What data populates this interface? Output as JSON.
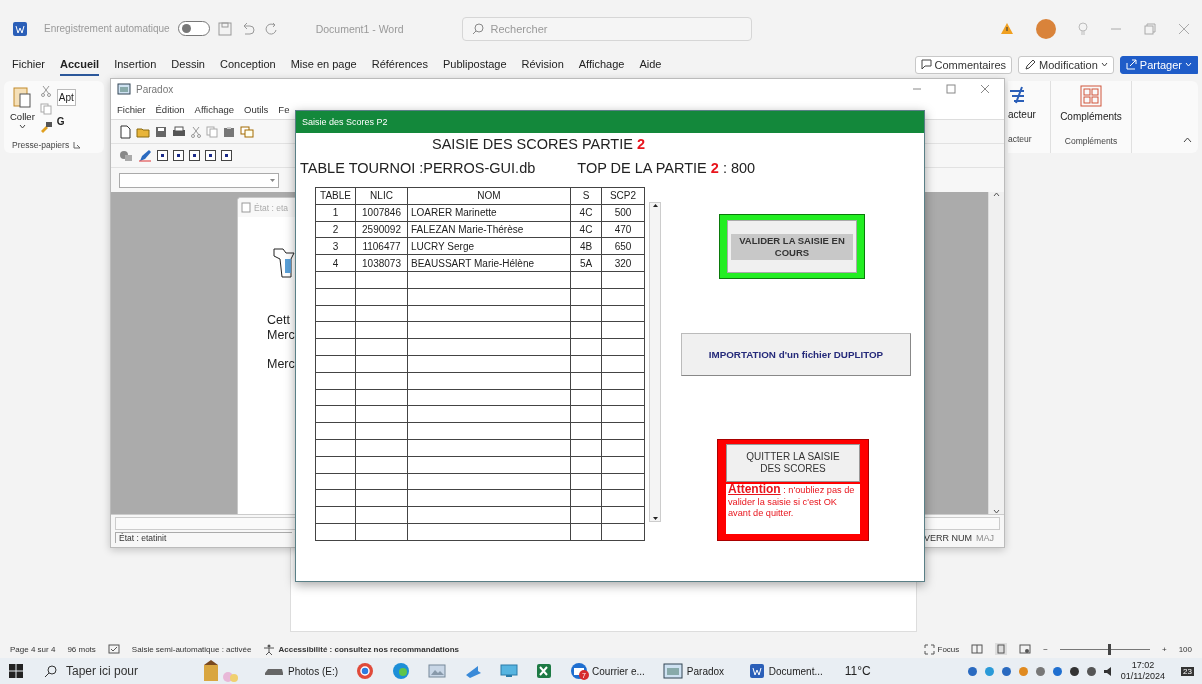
{
  "word": {
    "title": "Document1  -  Word",
    "autosave": {
      "label": "Enregistrement automatique",
      "on": false
    },
    "search": {
      "placeholder": "Rechercher"
    },
    "menu": [
      {
        "label": "Fichier",
        "selected": false
      },
      {
        "label": "Accueil",
        "selected": true
      },
      {
        "label": "Insertion",
        "selected": false
      },
      {
        "label": "Dessin",
        "selected": false
      },
      {
        "label": "Conception",
        "selected": false
      },
      {
        "label": "Mise en page",
        "selected": false
      },
      {
        "label": "Références",
        "selected": false
      },
      {
        "label": "Publipostage",
        "selected": false
      },
      {
        "label": "Révision",
        "selected": false
      },
      {
        "label": "Affichage",
        "selected": false
      },
      {
        "label": "Aide",
        "selected": false
      }
    ],
    "actions": [
      {
        "label": "Commentaires",
        "kind": "comment"
      },
      {
        "label": "Modification",
        "kind": "edit"
      },
      {
        "label": "Partager",
        "kind": "share"
      }
    ],
    "ribbon": {
      "paste": "Coller",
      "font_box": "Apt",
      "bold": "G",
      "clipboard_group": "Presse-papiers",
      "editor": "acteur",
      "editor_group": "acteur",
      "addins": "Compléments",
      "addins_group": "Compléments"
    },
    "status": {
      "page": "Page 4 sur 4",
      "words": "96 mots",
      "autocomplete": "Saisie semi-automatique : activée",
      "accessibility": "Accessibilité : consultez nos recommandations",
      "focus": "Focus",
      "zoom_out": "−",
      "zoom_slider": {
        "level": 0.55
      },
      "zoom_in": "+",
      "zoom": "100"
    }
  },
  "paradox": {
    "title": "Paradox",
    "menu": [
      "Fichier",
      "Édition",
      "Affichage",
      "Outils",
      "Fe"
    ],
    "report": {
      "title": "État : eta",
      "lines": [
        "Cett",
        "Merc",
        "Merc"
      ]
    },
    "status": "État : etatinit",
    "indicators": [
      {
        "label": "VERR NUM",
        "active": true
      },
      {
        "label": "MAJ",
        "active": false
      }
    ]
  },
  "dialog": {
    "title": "Saisie des Scores P2",
    "heading": "SAISIE DES SCORES PARTIE",
    "heading_number": "2",
    "table_name": "TABLE TOURNOI :PERROS-GUI.db",
    "top_label": "TOP DE LA PARTIE",
    "top_number": "2",
    "top_value": ": 800",
    "table": {
      "columns": [
        "TABLE",
        "NLIC",
        "NOM",
        "S",
        "SCP2"
      ],
      "rows": [
        [
          "1",
          "1007846",
          "LOARER Marinette",
          "4C",
          "500"
        ],
        [
          "2",
          "2590092",
          "FALEZAN Marie-Thérèse",
          "4C",
          "470"
        ],
        [
          "3",
          "1106477",
          "LUCRY Serge",
          "4B",
          "650"
        ],
        [
          "4",
          "1038073",
          "BEAUSSART Marie-Hélène",
          "5A",
          "320"
        ]
      ]
    },
    "validate_button": "VALIDER LA SAISIE EN COURS",
    "import_button": "IMPORTATION d'un fichier DUPLITOP",
    "quit_button": "QUITTER LA SAISIE DES SCORES",
    "warning": "**Attention** : n'oubliez pas de valider la saisie si c'est OK avant de quitter."
  },
  "taskbar": {
    "search": {
      "placeholder": "Taper ici pour"
    },
    "apps": [
      {
        "kind": "drive",
        "label": "Photos (E:)"
      },
      {
        "kind": "globe"
      },
      {
        "kind": "browser"
      },
      {
        "kind": "image"
      },
      {
        "kind": "arrow"
      },
      {
        "kind": "monitor"
      },
      {
        "kind": "spreadsheet"
      },
      {
        "kind": "mail",
        "label": "Courrier e...",
        "badge": "7"
      },
      {
        "kind": "database",
        "label": "Paradox"
      },
      {
        "kind": "document",
        "label": "Document..."
      }
    ],
    "weather": "11°C",
    "time": "17:02",
    "date": "01/11/2024",
    "notifications": "23"
  }
}
